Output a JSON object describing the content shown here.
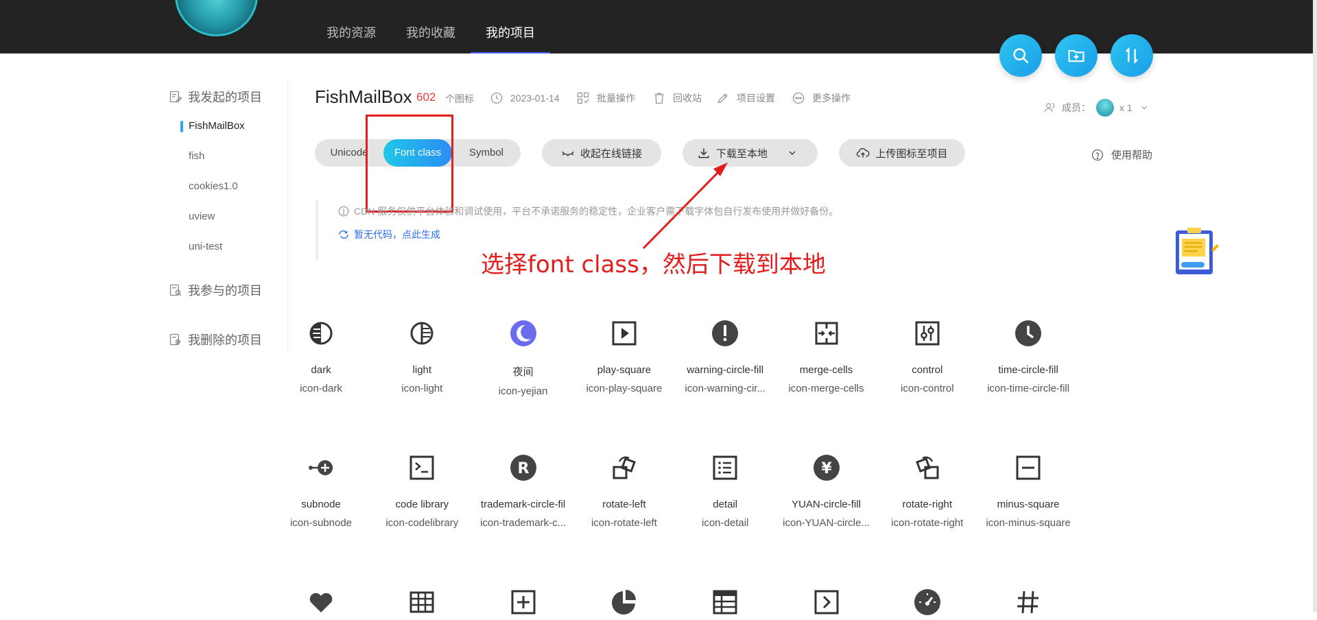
{
  "nav": {
    "tabs": [
      "我的资源",
      "我的收藏",
      "我的项目"
    ],
    "active_index": 2
  },
  "fabs": [
    "search-icon",
    "add-folder-icon",
    "sort-icon"
  ],
  "sidebar": {
    "created_heading": "我发起的项目",
    "projects": [
      "FishMailBox",
      "fish",
      "cookies1.0",
      "uview",
      "uni-test"
    ],
    "active_project": "FishMailBox",
    "joined_heading": "我参与的项目",
    "deleted_heading": "我删除的项目"
  },
  "header": {
    "project_name": "FishMailBox",
    "icon_count": "602",
    "icon_unit": "个图标",
    "date": "2023-01-14",
    "actions": {
      "batch": "批量操作",
      "recycle": "回收站",
      "settings": "项目设置",
      "more": "更多操作"
    },
    "members_label": "成员：",
    "members_count": "x 1"
  },
  "toolbar": {
    "segments": [
      "Unicode",
      "Font class",
      "Symbol"
    ],
    "active_segment": "Font class",
    "collapse_link": "收起在线链接",
    "download": "下载至本地",
    "upload": "上传图标至项目",
    "help": "使用帮助"
  },
  "notice": {
    "text": "CDN 服务仅供平台体验和调试使用，平台不承诺服务的稳定性，企业客户需下载字体包自行发布使用并做好备份。",
    "link": "暂无代码，点此生成"
  },
  "annotation": "选择font class，然后下载到本地",
  "colors": {
    "accent": "#2a8cf5",
    "annotation_red": "#e51c1c",
    "topbar": "#232323",
    "purple_icon": "#6b6bf0"
  },
  "icons": [
    {
      "name": "dark",
      "class": "icon-dark",
      "glyph": "dark-icon"
    },
    {
      "name": "light",
      "class": "icon-light",
      "glyph": "light-icon"
    },
    {
      "name": "夜间",
      "class": "icon-yejian",
      "glyph": "moon-icon"
    },
    {
      "name": "play-square",
      "class": "icon-play-square",
      "glyph": "play-square-icon"
    },
    {
      "name": "warning-circle-fill",
      "class": "icon-warning-cir...",
      "glyph": "warning-circle-icon"
    },
    {
      "name": "merge-cells",
      "class": "icon-merge-cells",
      "glyph": "merge-cells-icon"
    },
    {
      "name": "control",
      "class": "icon-control",
      "glyph": "control-icon"
    },
    {
      "name": "time-circle-fill",
      "class": "icon-time-circle-fill",
      "glyph": "time-circle-icon"
    },
    {
      "name": "subnode",
      "class": "icon-subnode",
      "glyph": "subnode-icon"
    },
    {
      "name": "code library",
      "class": "icon-codelibrary",
      "glyph": "code-library-icon"
    },
    {
      "name": "trademark-circle-fil",
      "class": "icon-trademark-c...",
      "glyph": "trademark-icon"
    },
    {
      "name": "rotate-left",
      "class": "icon-rotate-left",
      "glyph": "rotate-left-icon"
    },
    {
      "name": "detail",
      "class": "icon-detail",
      "glyph": "detail-icon"
    },
    {
      "name": "YUAN-circle-fill",
      "class": "icon-YUAN-circle...",
      "glyph": "yuan-circle-icon"
    },
    {
      "name": "rotate-right",
      "class": "icon-rotate-right",
      "glyph": "rotate-right-icon"
    },
    {
      "name": "minus-square",
      "class": "icon-minus-square",
      "glyph": "minus-square-icon"
    },
    {
      "name": "",
      "class": "",
      "glyph": "heart-icon"
    },
    {
      "name": "",
      "class": "",
      "glyph": "table-icon"
    },
    {
      "name": "",
      "class": "",
      "glyph": "plus-square-icon"
    },
    {
      "name": "",
      "class": "",
      "glyph": "pie-chart-icon"
    },
    {
      "name": "",
      "class": "",
      "glyph": "table-rows-icon"
    },
    {
      "name": "",
      "class": "",
      "glyph": "right-square-icon"
    },
    {
      "name": "",
      "class": "",
      "glyph": "dashboard-icon"
    },
    {
      "name": "",
      "class": "",
      "glyph": "number-icon"
    }
  ]
}
